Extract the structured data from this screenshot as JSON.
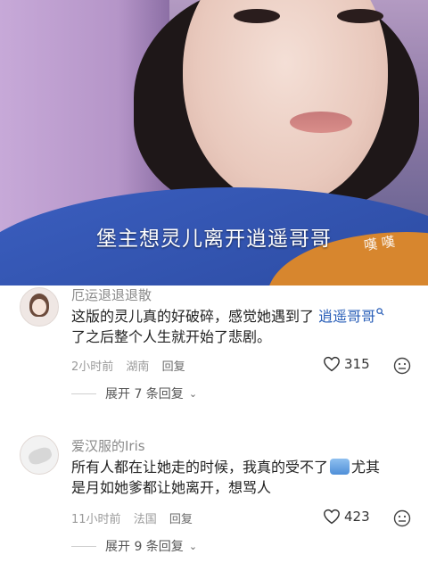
{
  "video": {
    "subtitle": "堡主想灵儿离开逍遥哥哥",
    "watermark": "嘆 嘆"
  },
  "comments": [
    {
      "username": "厄运退退退散",
      "text_before": "这版的灵儿真的好破碎，感觉她遇到了 ",
      "link": "逍遥哥哥",
      "link_icon": "search-icon",
      "text_after": "了之后整个人生就开始了悲剧。",
      "time": "2小时前",
      "location": "湖南",
      "reply_label": "回复",
      "likes": "315",
      "expand_label": "展开 7 条回复"
    },
    {
      "username": "爱汉服的Iris",
      "text_line1": "所有人都在让她走的时候，我真的受不了",
      "text_line1_tail": "尤其",
      "text_line2": "是月如她爹都让她离开，想骂人",
      "time": "11小时前",
      "location": "法国",
      "reply_label": "回复",
      "likes": "423",
      "expand_label": "展开 9 条回复"
    }
  ]
}
